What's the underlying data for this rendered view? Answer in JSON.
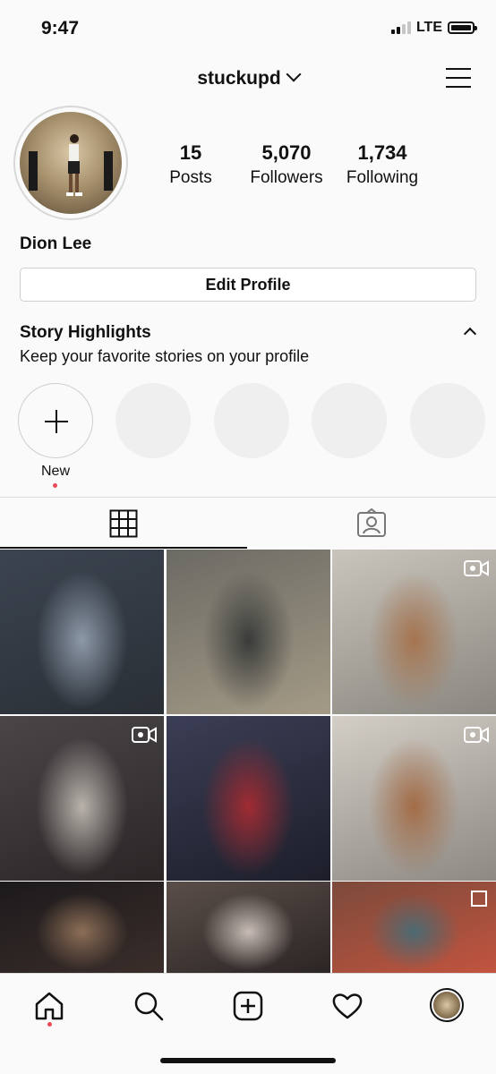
{
  "status_bar": {
    "time": "9:47",
    "network": "LTE"
  },
  "header": {
    "username": "stuckupd"
  },
  "profile": {
    "full_name": "Dion Lee",
    "stats": [
      {
        "value": "15",
        "label": "Posts"
      },
      {
        "value": "5,070",
        "label": "Followers"
      },
      {
        "value": "1,734",
        "label": "Following"
      }
    ],
    "edit_button_label": "Edit Profile"
  },
  "highlights": {
    "title": "Story Highlights",
    "subtitle": "Keep your favorite stories on your profile",
    "new_label": "New"
  },
  "tabs": [
    {
      "icon": "grid-icon",
      "selected": true
    },
    {
      "icon": "tagged-icon",
      "selected": false
    }
  ],
  "grid_posts": [
    {
      "type": "photo",
      "colors": [
        "#3c4450",
        "#8d99a8",
        "#2a2f36"
      ]
    },
    {
      "type": "photo",
      "colors": [
        "#6b6a64",
        "#3a3c3a",
        "#a49a86"
      ]
    },
    {
      "type": "video",
      "colors": [
        "#c9c5bd",
        "#a5744f",
        "#8a8780"
      ]
    },
    {
      "type": "video",
      "colors": [
        "#4a4648",
        "#b9b3ac",
        "#2b2526"
      ]
    },
    {
      "type": "photo",
      "colors": [
        "#3b3e55",
        "#a02b32",
        "#1d1e2a"
      ]
    },
    {
      "type": "video",
      "colors": [
        "#d3cec6",
        "#a36c47",
        "#8d8983"
      ]
    },
    {
      "type": "photo",
      "colors": [
        "#1d1a1c",
        "#8c6e57",
        "#3a2e2a"
      ]
    },
    {
      "type": "photo",
      "colors": [
        "#5a4e49",
        "#c7bcb6",
        "#2b2524"
      ]
    },
    {
      "type": "multi",
      "colors": [
        "#7c4a3b",
        "#4b6a73",
        "#c2543f"
      ]
    }
  ],
  "bottom_nav": [
    "home-icon",
    "search-icon",
    "new-post-icon",
    "activity-heart-icon",
    "profile-avatar"
  ]
}
